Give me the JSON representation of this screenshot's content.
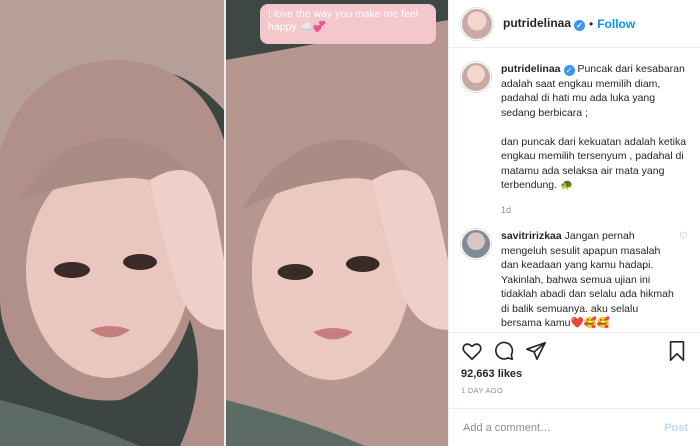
{
  "post": {
    "username": "putridelinaa",
    "follow_label": "Follow",
    "separator": "•"
  },
  "media": {
    "caption_sticker_text": "I love the way you make me feel happy",
    "caption_sticker_emoji": "☁️💞"
  },
  "caption": {
    "username": "putridelinaa",
    "text": "Puncak dari kesabaran adalah saat engkau memilih diam, padahal di hati mu ada luka yang sedang berbicara ;\n\ndan puncak dari kekuatan adalah ketika engkau memilih tersenyum , padahal di matamu ada selaksa air mata yang terbendung. 🐢",
    "time": "1d"
  },
  "comments": [
    {
      "username": "savitririzkaa",
      "text": "Jangan pernah mengeluh sesulit apapun masalah dan keadaan yang kamu hadapi. Yakinlah, bahwa semua ujian ini tidaklah abadi dan selalu ada hikmah di balik semuanya. aku selalu bersama kamu❤️🥰🥰"
    }
  ],
  "engagement": {
    "likes": "92,663 likes",
    "posted_ago": "1 DAY AGO"
  },
  "composer": {
    "placeholder": "Add a comment…",
    "post_label": "Post"
  },
  "colors": {
    "accent": "#0095f6",
    "verified": "#3897f0",
    "sticker_bg": "#f4c7cc",
    "hijab": "#b99e96"
  },
  "icons": [
    "verified-badge-icon",
    "heart-icon",
    "comment-icon",
    "share-icon",
    "bookmark-icon",
    "small-heart-icon"
  ]
}
